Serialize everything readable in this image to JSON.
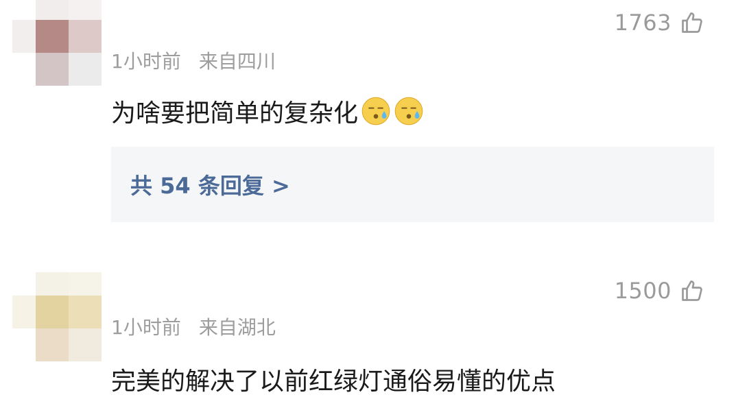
{
  "comments": [
    {
      "likes": "1763",
      "time": "1小时前",
      "location": "来自四川",
      "text": "为啥要把简单的复杂化",
      "emoji": [
        "sweat-face",
        "sweat-face"
      ],
      "replies_label": "共 54 条回复 >"
    },
    {
      "likes": "1500",
      "time": "1小时前",
      "location": "来自湖北",
      "text": "完美的解决了以前红绿灯通俗易懂的优点"
    }
  ]
}
